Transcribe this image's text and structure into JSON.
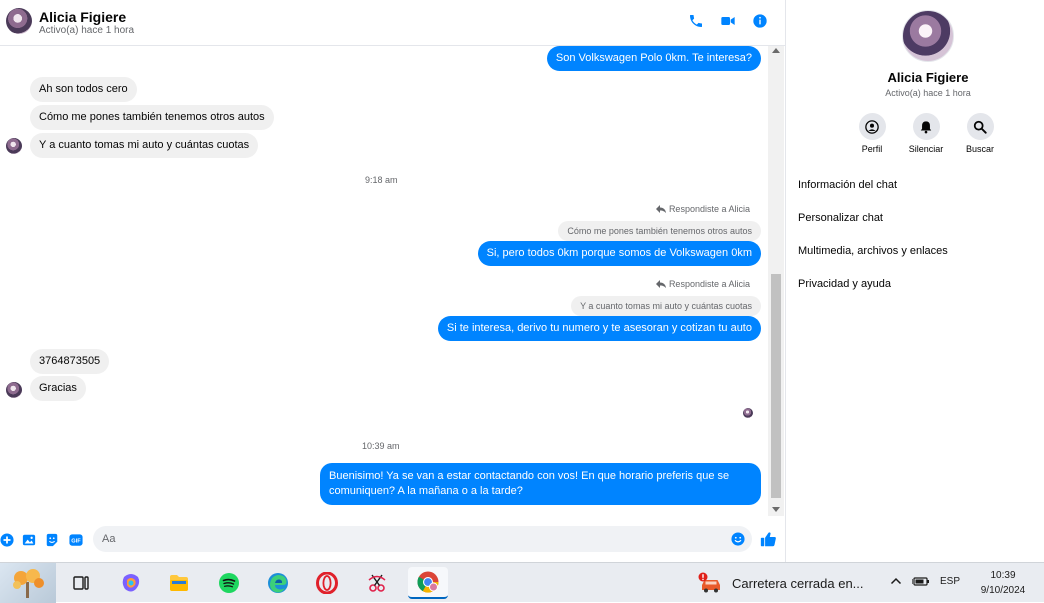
{
  "chat": {
    "contact_name": "Alicia Figiere",
    "status": "Activo(a) hace 1 hora",
    "messages": {
      "out1": "Son Volkswagen Polo 0km. Te interesa?",
      "in1": "Ah son todos cero",
      "in2": "Cómo me pones también tenemos otros autos",
      "in3": "Y a cuanto tomas mi auto y cuántas cuotas",
      "time1": "9:18 am",
      "reply_note1": "Respondiste a Alicia",
      "quoted1": "Cómo me pones también tenemos otros autos",
      "out2": "Si, pero todos 0km porque somos de Volkswagen 0km",
      "reply_note2": "Respondiste a Alicia",
      "quoted2": "Y a cuanto tomas mi auto y cuántas cuotas",
      "out3": "Si te interesa, derivo tu numero y te asesoran y cotizan tu auto",
      "in4": "3764873505",
      "in5": "Gracias",
      "time2": "10:39 am",
      "out4_line1": "Buenisimo! Ya se van a estar contactando con vos! En que horario preferis que se",
      "out4_line2": "comuniquen? A la mañana o a la tarde?"
    },
    "composer_placeholder": "Aa"
  },
  "info_panel": {
    "name": "Alicia Figiere",
    "status": "Activo(a) hace 1 hora",
    "actions": [
      "Perfil",
      "Silenciar",
      "Buscar"
    ],
    "menu": [
      "Información del chat",
      "Personalizar chat",
      "Multimedia, archivos y enlaces",
      "Privacidad y ayuda"
    ]
  },
  "taskbar": {
    "weather_text": "Carretera cerrada en...",
    "language": "ESP",
    "time": "10:39",
    "date": "9/10/2024"
  },
  "colors": {
    "accent": "#0084ff",
    "incoming_bubble": "#f0f0f0",
    "header_icon": "#0084ff"
  }
}
